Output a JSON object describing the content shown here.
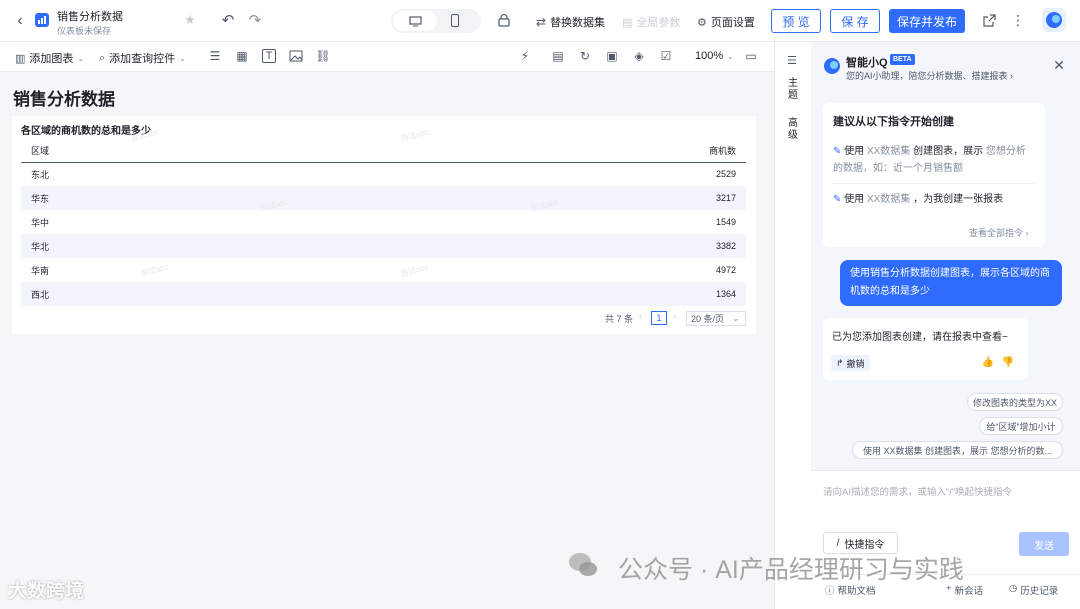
{
  "header": {
    "title": "销售分析数据",
    "subtitle": "仪表板未保存",
    "switch_dataset": "替换数据集",
    "global_params": "全局参数",
    "page_settings": "页面设置",
    "preview": "预 览",
    "save": "保 存",
    "save_publish": "保存并发布"
  },
  "toolbar": {
    "add_chart": "添加图表",
    "add_query": "添加查询控件",
    "zoom": "100%"
  },
  "canvas": {
    "page_title": "销售分析数据",
    "chart_title": "各区域的商机数的总和是多少",
    "columns": [
      "区域",
      "商机数"
    ],
    "rows": [
      {
        "region": "东北",
        "value": "2529"
      },
      {
        "region": "华东",
        "value": "3217"
      },
      {
        "region": "华中",
        "value": "1549"
      },
      {
        "region": "华北",
        "value": "3382"
      },
      {
        "region": "华南",
        "value": "4972"
      },
      {
        "region": "西北",
        "value": "1364"
      }
    ],
    "total": "共 7 条",
    "page": "1",
    "page_size": "20 条/页"
  },
  "sidetabs": {
    "theme": "主题",
    "advanced": "高级"
  },
  "assistant": {
    "name": "智能小Q",
    "badge": "BETA",
    "desc": "您的AI小助理，陪您分析数据、搭建报表",
    "suggest_title": "建议从以下指令开始创建",
    "cmd1_a": "使用",
    "cmd1_b": "XX数据集",
    "cmd1_c": "创建图表，展示",
    "cmd1_d": "您想分析的数据，如：近一个月销售额",
    "cmd2_a": "使用",
    "cmd2_b": "XX数据集",
    "cmd2_c": "，为我创建一张报表",
    "view_all": "查看全部指令",
    "user_msg": "使用销售分析数据创建图表，展示各区域的商机数的总和是多少",
    "reply": "已为您添加图表创建，请在报表中查看~",
    "undo": "撤销",
    "chip1": "修改图表的类型为XX",
    "chip2": "给“区域”增加小计",
    "chip3": "使用 XX数据集 创建图表，展示 您想分析的数...",
    "input_placeholder": "请向AI描述您的需求，或输入“/”唤起快捷指令",
    "quick": "快捷指令",
    "send": "发送",
    "help": "帮助文档",
    "new_chat": "新会话",
    "history": "历史记录"
  },
  "watermark": {
    "left": "大数跨境",
    "right": "公众号 · AI产品经理研习与实践",
    "tile": "测试abc"
  },
  "colors": {
    "accent": "#2f6bff",
    "header_rule": "#4d5a75",
    "row_alt": "#f2f5fb"
  }
}
